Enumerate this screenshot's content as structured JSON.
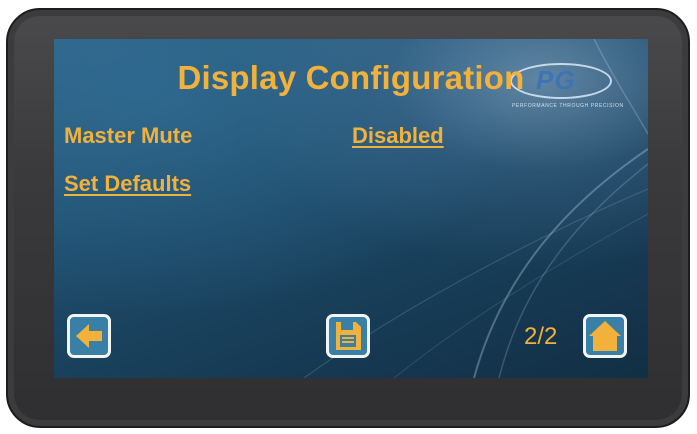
{
  "screen": {
    "title": "Display Configuration",
    "logo": {
      "text": "PG",
      "tagline": "PERFORMANCE THROUGH PRECISION"
    },
    "settings": [
      {
        "label": "Master Mute",
        "value": "Disabled"
      }
    ],
    "set_defaults_label": "Set Defaults",
    "page_indicator": "2/2"
  },
  "icons": {
    "back": "arrow-left-icon",
    "save": "floppy-disk-icon",
    "home": "home-icon"
  },
  "colors": {
    "accent": "#f2b13a",
    "button_fill": "#3a7fa6",
    "screen_bg": "#1f4e6d",
    "bezel": "#3a3a3c"
  }
}
